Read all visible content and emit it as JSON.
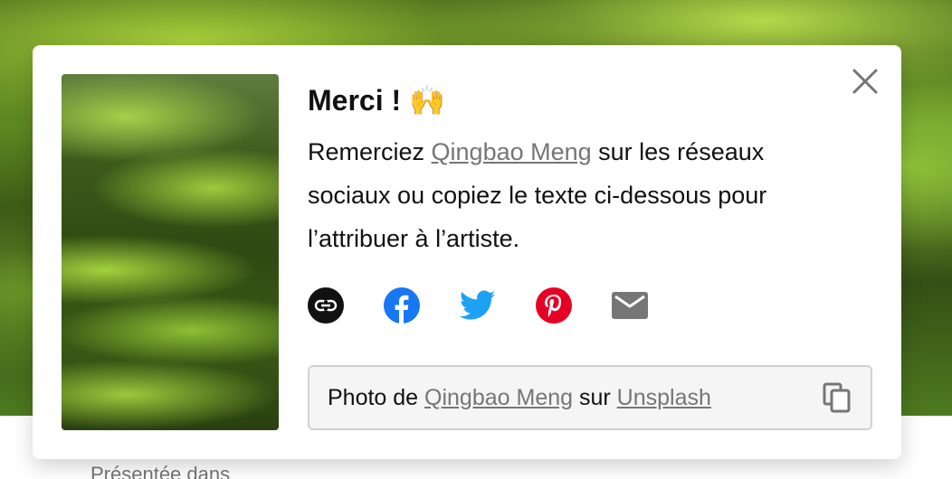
{
  "modal": {
    "title": "Merci !",
    "title_emoji": "🙌",
    "description_prefix": "Remerciez ",
    "artist_name": "Qingbao Meng",
    "description_suffix": " sur les réseaux sociaux ou copiez le texte ci-dessous pour l’attribuer à l’artiste.",
    "share_icons": [
      "link-icon",
      "facebook-icon",
      "twitter-icon",
      "pinterest-icon",
      "email-icon"
    ],
    "credit": {
      "prefix": "Photo de ",
      "artist_name": "Qingbao Meng",
      "middle": " sur ",
      "site_name": "Unsplash"
    }
  },
  "page_below": {
    "text": "Présentée dans"
  },
  "colors": {
    "facebook": "#1877F2",
    "twitter": "#1DA1F2",
    "pinterest": "#E60023",
    "muted": "#767676"
  }
}
